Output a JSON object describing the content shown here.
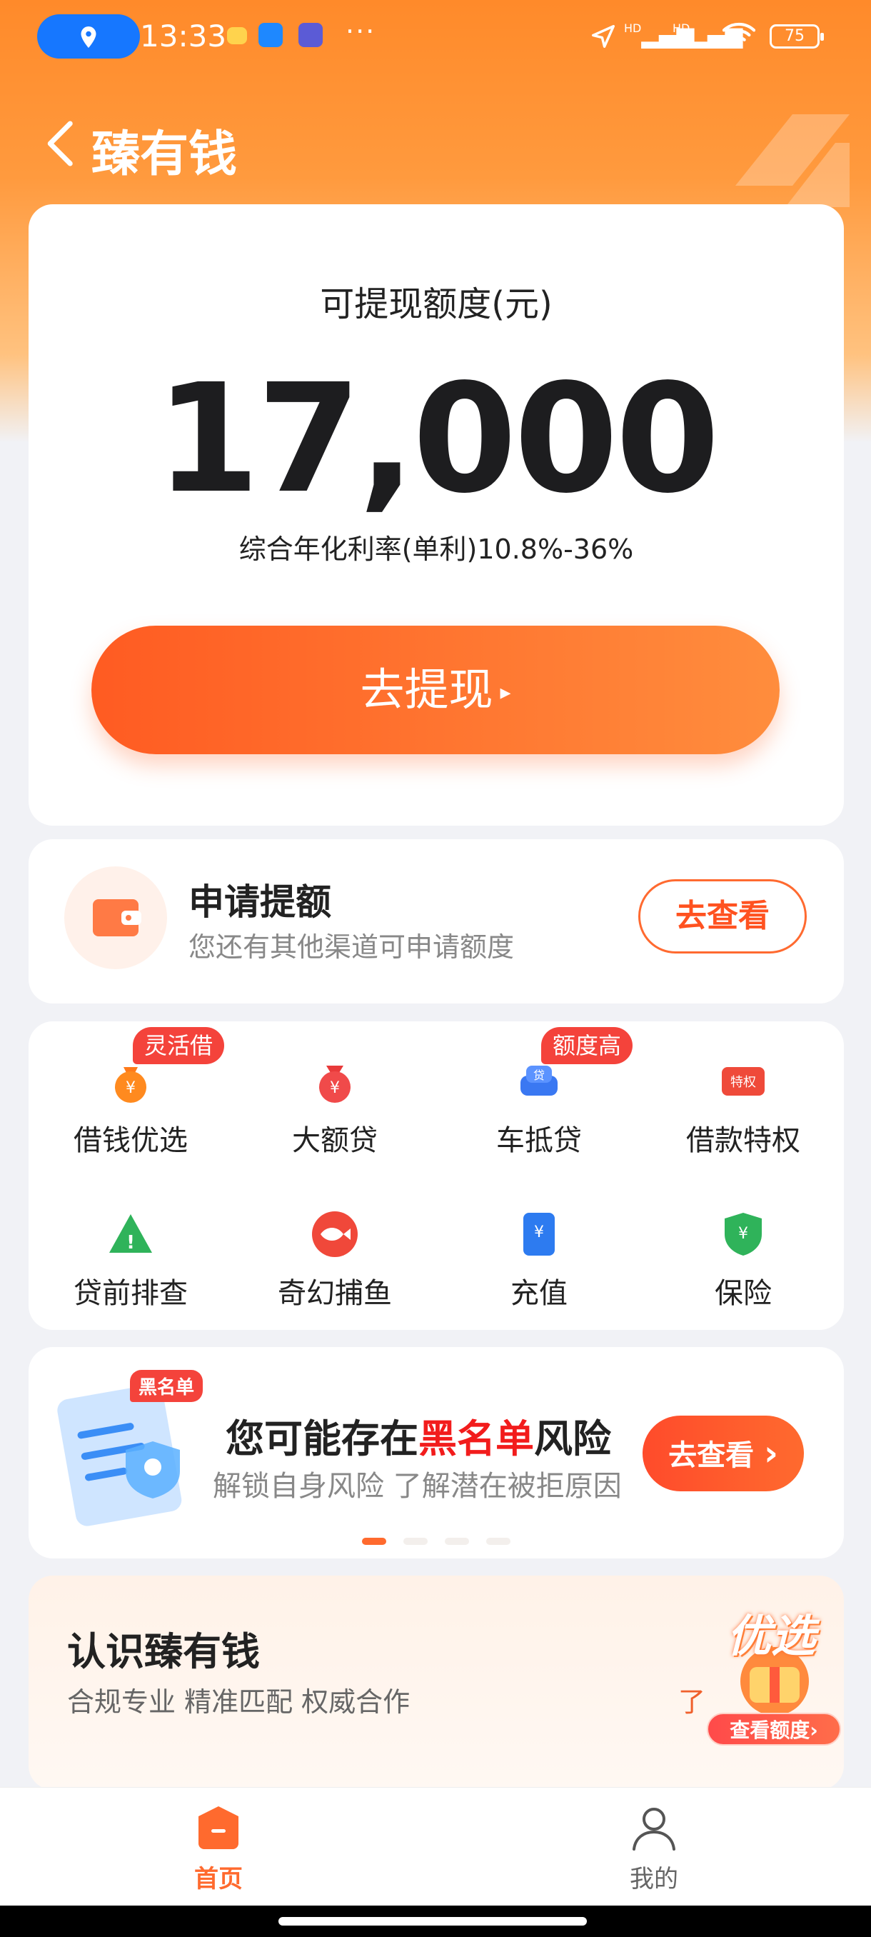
{
  "status_bar": {
    "time": "13:33",
    "more": "···",
    "signal1": "HD",
    "signal2": "HD",
    "battery": "75"
  },
  "nav": {
    "title": "臻有钱"
  },
  "quota": {
    "label": "可提现额度(元)",
    "amount": "17,000",
    "rate": "综合年化利率(单利)10.8%-36%",
    "withdraw_label": "去提现",
    "withdraw_arrow": "▸"
  },
  "raise": {
    "title": "申请提额",
    "subtitle": "您还有其他渠道可申请额度",
    "button": "去查看"
  },
  "grid": {
    "items": [
      {
        "label": "借钱优选",
        "badge": "灵活借",
        "icon": "money-bag-icon"
      },
      {
        "label": "大额贷",
        "badge": "",
        "icon": "red-bag-icon"
      },
      {
        "label": "车抵贷",
        "badge": "额度高",
        "icon": "car-loan-icon"
      },
      {
        "label": "借款特权",
        "badge": "",
        "icon": "privilege-icon"
      },
      {
        "label": "贷前排查",
        "badge": "",
        "icon": "warning-icon"
      },
      {
        "label": "奇幻捕鱼",
        "badge": "",
        "icon": "fish-icon"
      },
      {
        "label": "充值",
        "badge": "",
        "icon": "recharge-icon"
      },
      {
        "label": "保险",
        "badge": "",
        "icon": "insurance-icon"
      }
    ],
    "icon_texts": {
      "yen": "¥",
      "dai": "贷",
      "tequan": "特权",
      "excl": "!"
    }
  },
  "banner": {
    "title_pre": "您可能存在",
    "title_red": "黑名单",
    "title_post": "风险",
    "subtitle": "解锁自身风险 了解潜在被拒原因",
    "button": "去查看",
    "button_arrow": "›",
    "tag": "黑名单"
  },
  "about": {
    "title": "认识臻有钱",
    "subtitle": "合规专业 精准匹配 权威合作",
    "cut": "了"
  },
  "float": {
    "word": "优选",
    "pill": "查看额度›"
  },
  "tabs": [
    {
      "label": "首页",
      "color": "#ff6a2e"
    },
    {
      "label": "我的",
      "color": "#666666"
    }
  ],
  "colors": {
    "primary": "#ff6a2e",
    "danger": "#f4433b"
  }
}
